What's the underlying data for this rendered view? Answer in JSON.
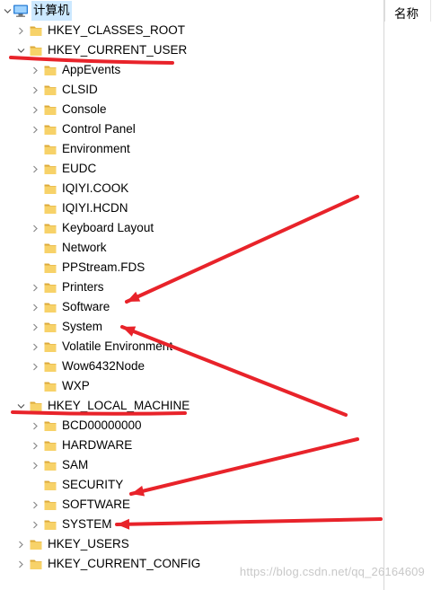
{
  "tree": {
    "root": {
      "label": "计算机",
      "icon": "computer-icon"
    },
    "hives": [
      {
        "id": "hkcr",
        "label": "HKEY_CLASSES_ROOT",
        "expanded": false,
        "children": []
      },
      {
        "id": "hkcu",
        "label": "HKEY_CURRENT_USER",
        "expanded": true,
        "children": [
          {
            "label": "AppEvents",
            "has_children": true
          },
          {
            "label": "CLSID",
            "has_children": true
          },
          {
            "label": "Console",
            "has_children": true
          },
          {
            "label": "Control Panel",
            "has_children": true
          },
          {
            "label": "Environment",
            "has_children": false
          },
          {
            "label": "EUDC",
            "has_children": true
          },
          {
            "label": "IQIYI.COOK",
            "has_children": false
          },
          {
            "label": "IQIYI.HCDN",
            "has_children": false
          },
          {
            "label": "Keyboard Layout",
            "has_children": true
          },
          {
            "label": "Network",
            "has_children": false
          },
          {
            "label": "PPStream.FDS",
            "has_children": false
          },
          {
            "label": "Printers",
            "has_children": true
          },
          {
            "label": "Software",
            "has_children": true
          },
          {
            "label": "System",
            "has_children": true
          },
          {
            "label": "Volatile Environment",
            "has_children": true
          },
          {
            "label": "Wow6432Node",
            "has_children": true
          },
          {
            "label": "WXP",
            "has_children": false
          }
        ]
      },
      {
        "id": "hklm",
        "label": "HKEY_LOCAL_MACHINE",
        "expanded": true,
        "children": [
          {
            "label": "BCD00000000",
            "has_children": true
          },
          {
            "label": "HARDWARE",
            "has_children": true
          },
          {
            "label": "SAM",
            "has_children": true
          },
          {
            "label": "SECURITY",
            "has_children": false
          },
          {
            "label": "SOFTWARE",
            "has_children": true
          },
          {
            "label": "SYSTEM",
            "has_children": true
          }
        ]
      },
      {
        "id": "hku",
        "label": "HKEY_USERS",
        "expanded": false,
        "children": []
      },
      {
        "id": "hkcc",
        "label": "HKEY_CURRENT_CONFIG",
        "expanded": false,
        "children": []
      }
    ]
  },
  "list": {
    "column_name": "名称"
  },
  "watermark": "https://blog.csdn.net/qq_26164609",
  "colors": {
    "annotation": "#e8232a",
    "folder": "#f7d269",
    "folder_edge": "#dcaa3a",
    "selection": "#cce8ff",
    "text": "#000000"
  }
}
